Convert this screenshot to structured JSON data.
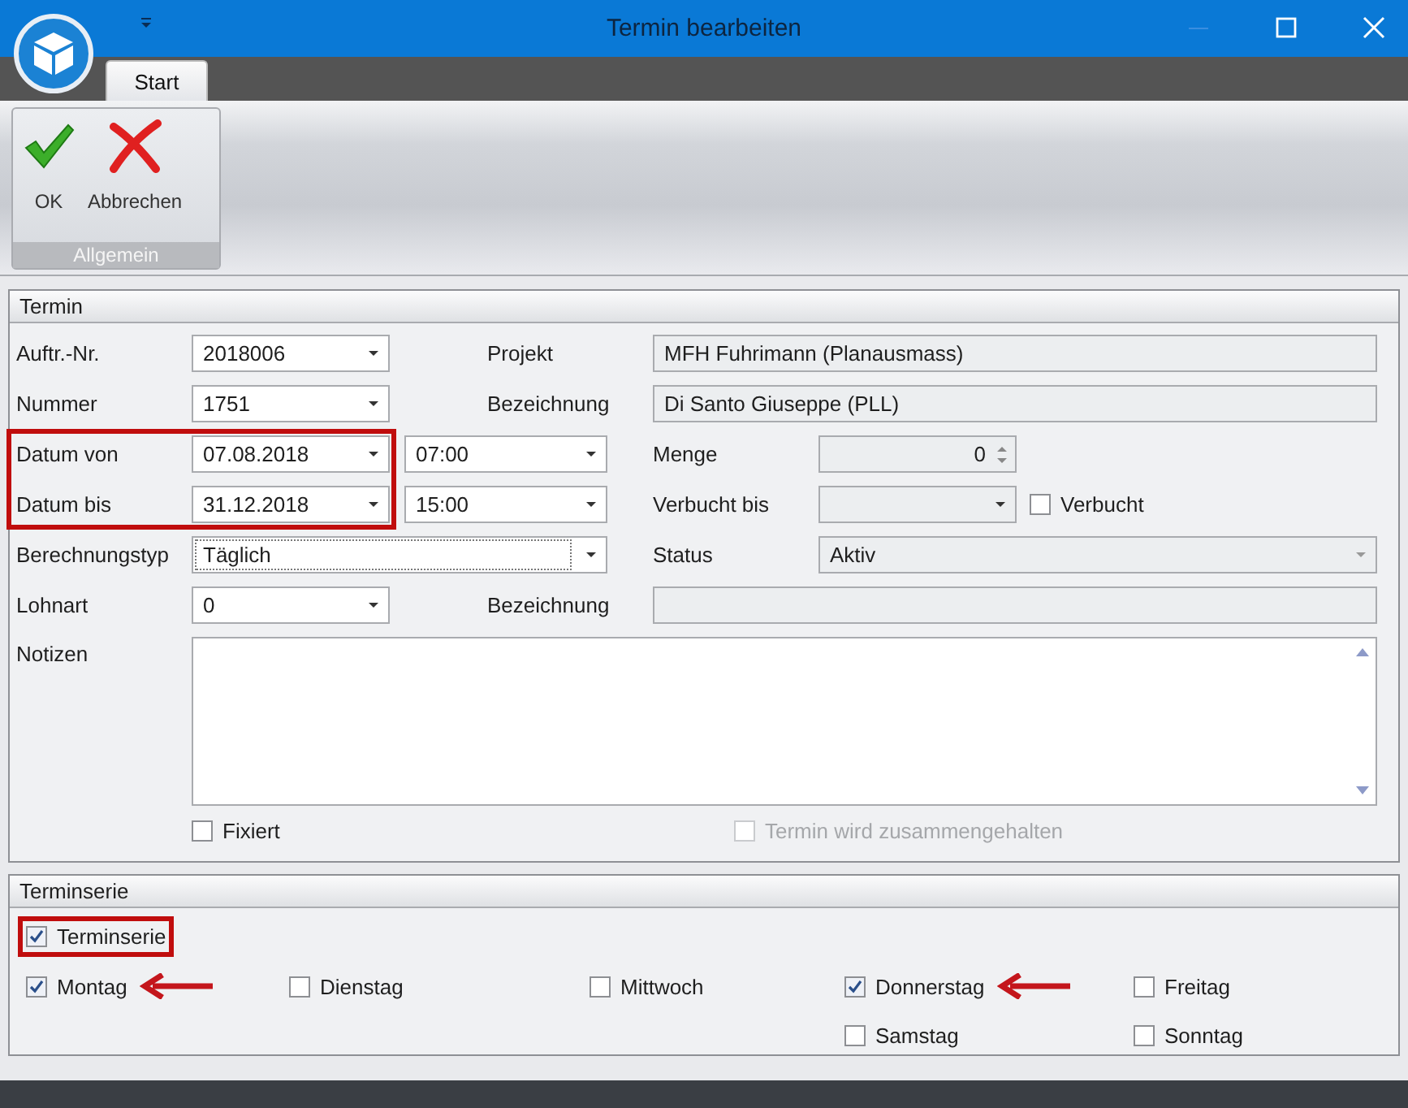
{
  "window": {
    "title": "Termin bearbeiten"
  },
  "tabs": [
    {
      "label": "Start",
      "selected": true
    }
  ],
  "ribbon_groups": [
    {
      "label": "Allgemein",
      "buttons": [
        {
          "label": "OK",
          "kind": "ok"
        },
        {
          "label": "Abbrechen",
          "kind": "cancel"
        }
      ]
    }
  ],
  "termin": {
    "title": "Termin",
    "auftr_nr": {
      "label": "Auftr.-Nr.",
      "value": "2018006"
    },
    "projekt": {
      "label": "Projekt",
      "value": "MFH Fuhrimann (Planausmass)"
    },
    "nummer": {
      "label": "Nummer",
      "value": "1751"
    },
    "bezeichnung": {
      "label": "Bezeichnung",
      "value": "Di Santo Giuseppe (PLL)"
    },
    "datum_von": {
      "label": "Datum von",
      "value": "07.08.2018"
    },
    "zeit_von": {
      "value": "07:00"
    },
    "menge": {
      "label": "Menge",
      "value": "0"
    },
    "datum_bis": {
      "label": "Datum bis",
      "value": "31.12.2018"
    },
    "zeit_bis": {
      "value": "15:00"
    },
    "verbucht_bis": {
      "label": "Verbucht bis"
    },
    "verbucht": {
      "label": "Verbucht",
      "checked": false
    },
    "berechnungstyp": {
      "label": "Berechnungstyp",
      "value": "Täglich"
    },
    "status": {
      "label": "Status",
      "value": "Aktiv"
    },
    "lohnart": {
      "label": "Lohnart",
      "value": "0"
    },
    "lohnart_bezeichnung": {
      "label": "Bezeichnung"
    },
    "notizen": {
      "label": "Notizen"
    },
    "fixiert": {
      "label": "Fixiert",
      "checked": false
    },
    "zusammengehalten": {
      "label": "Termin wird zusammengehalten",
      "checked": false,
      "disabled": true
    },
    "date_range_highlighted": true
  },
  "terminserie": {
    "title": "Terminserie",
    "toggle": {
      "label": "Terminserie",
      "checked": true,
      "highlighted": true
    },
    "days": [
      {
        "label": "Montag",
        "checked": true,
        "arrow": true
      },
      {
        "label": "Dienstag",
        "checked": false,
        "arrow": false
      },
      {
        "label": "Mittwoch",
        "checked": false,
        "arrow": false
      },
      {
        "label": "Donnerstag",
        "checked": true,
        "arrow": true
      },
      {
        "label": "Freitag",
        "checked": false,
        "arrow": false
      },
      {
        "label": "Samstag",
        "checked": false,
        "arrow": false
      },
      {
        "label": "Sonntag",
        "checked": false,
        "arrow": false
      }
    ]
  }
}
